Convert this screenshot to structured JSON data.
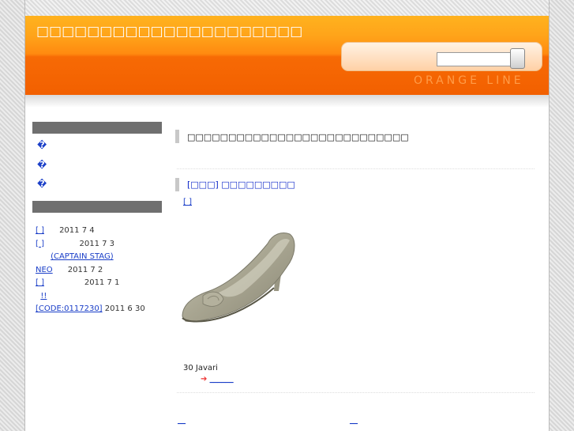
{
  "header": {
    "title": "□□□□□□□□□□□□□□□□□□□□□",
    "search_placeholder": "",
    "tagline": "ORANGE LINE"
  },
  "sidebar": {
    "links": [
      "�",
      "�",
      "�"
    ],
    "recent": [
      {
        "title": "[ ]",
        "date": "2011 7 4"
      },
      {
        "title": "[ ]",
        "date": "2011 7 3"
      },
      {
        "title": "(CAPTAIN STAG)",
        "date": ""
      },
      {
        "title": "NEO",
        "date": "2011 7 2"
      },
      {
        "title": "[ ]",
        "date": "2011 7 1"
      },
      {
        "title": "!!",
        "date": ""
      },
      {
        "title": "[CODE:0117230]",
        "date": "2011 6 30"
      }
    ]
  },
  "main": {
    "notice": "□□□□□□□□□□□□□□□□□□□□□□□□□□□",
    "post": {
      "title": "[□□□] □□□□□□□□□",
      "category": "[ ]",
      "body": "30      Javari",
      "read_more_arrow": "➔",
      "read_more": "______"
    },
    "pager": {
      "prev": "__",
      "next": "__"
    }
  }
}
